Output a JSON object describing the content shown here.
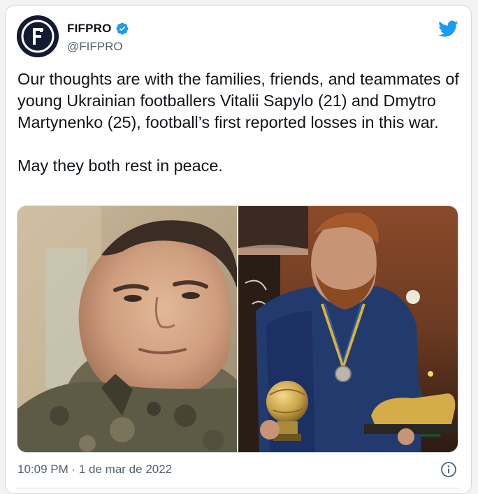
{
  "account": {
    "display_name": "FIFPRO",
    "handle": "@FIFPRO",
    "verified": true,
    "avatar_letter": "F"
  },
  "tweet": {
    "text_paragraph_1": "Our thoughts are with the families, friends, and teammates of young Ukrainian footballers Vitalii Sapylo (21) and Dmytro Martynenko (25), football’s first reported losses in this war.",
    "text_paragraph_2": "May they both rest in peace.",
    "timestamp": "10:09 PM · 1 de mar de 2022"
  },
  "media": {
    "photo_count": 2
  },
  "icons": {
    "brand": "twitter-bird-icon",
    "verified": "verified-badge-icon",
    "info": "info-icon"
  },
  "colors": {
    "text_primary": "#0f1419",
    "text_secondary": "#536471",
    "twitter_blue": "#1d9bf0",
    "border": "#cfd9de"
  }
}
